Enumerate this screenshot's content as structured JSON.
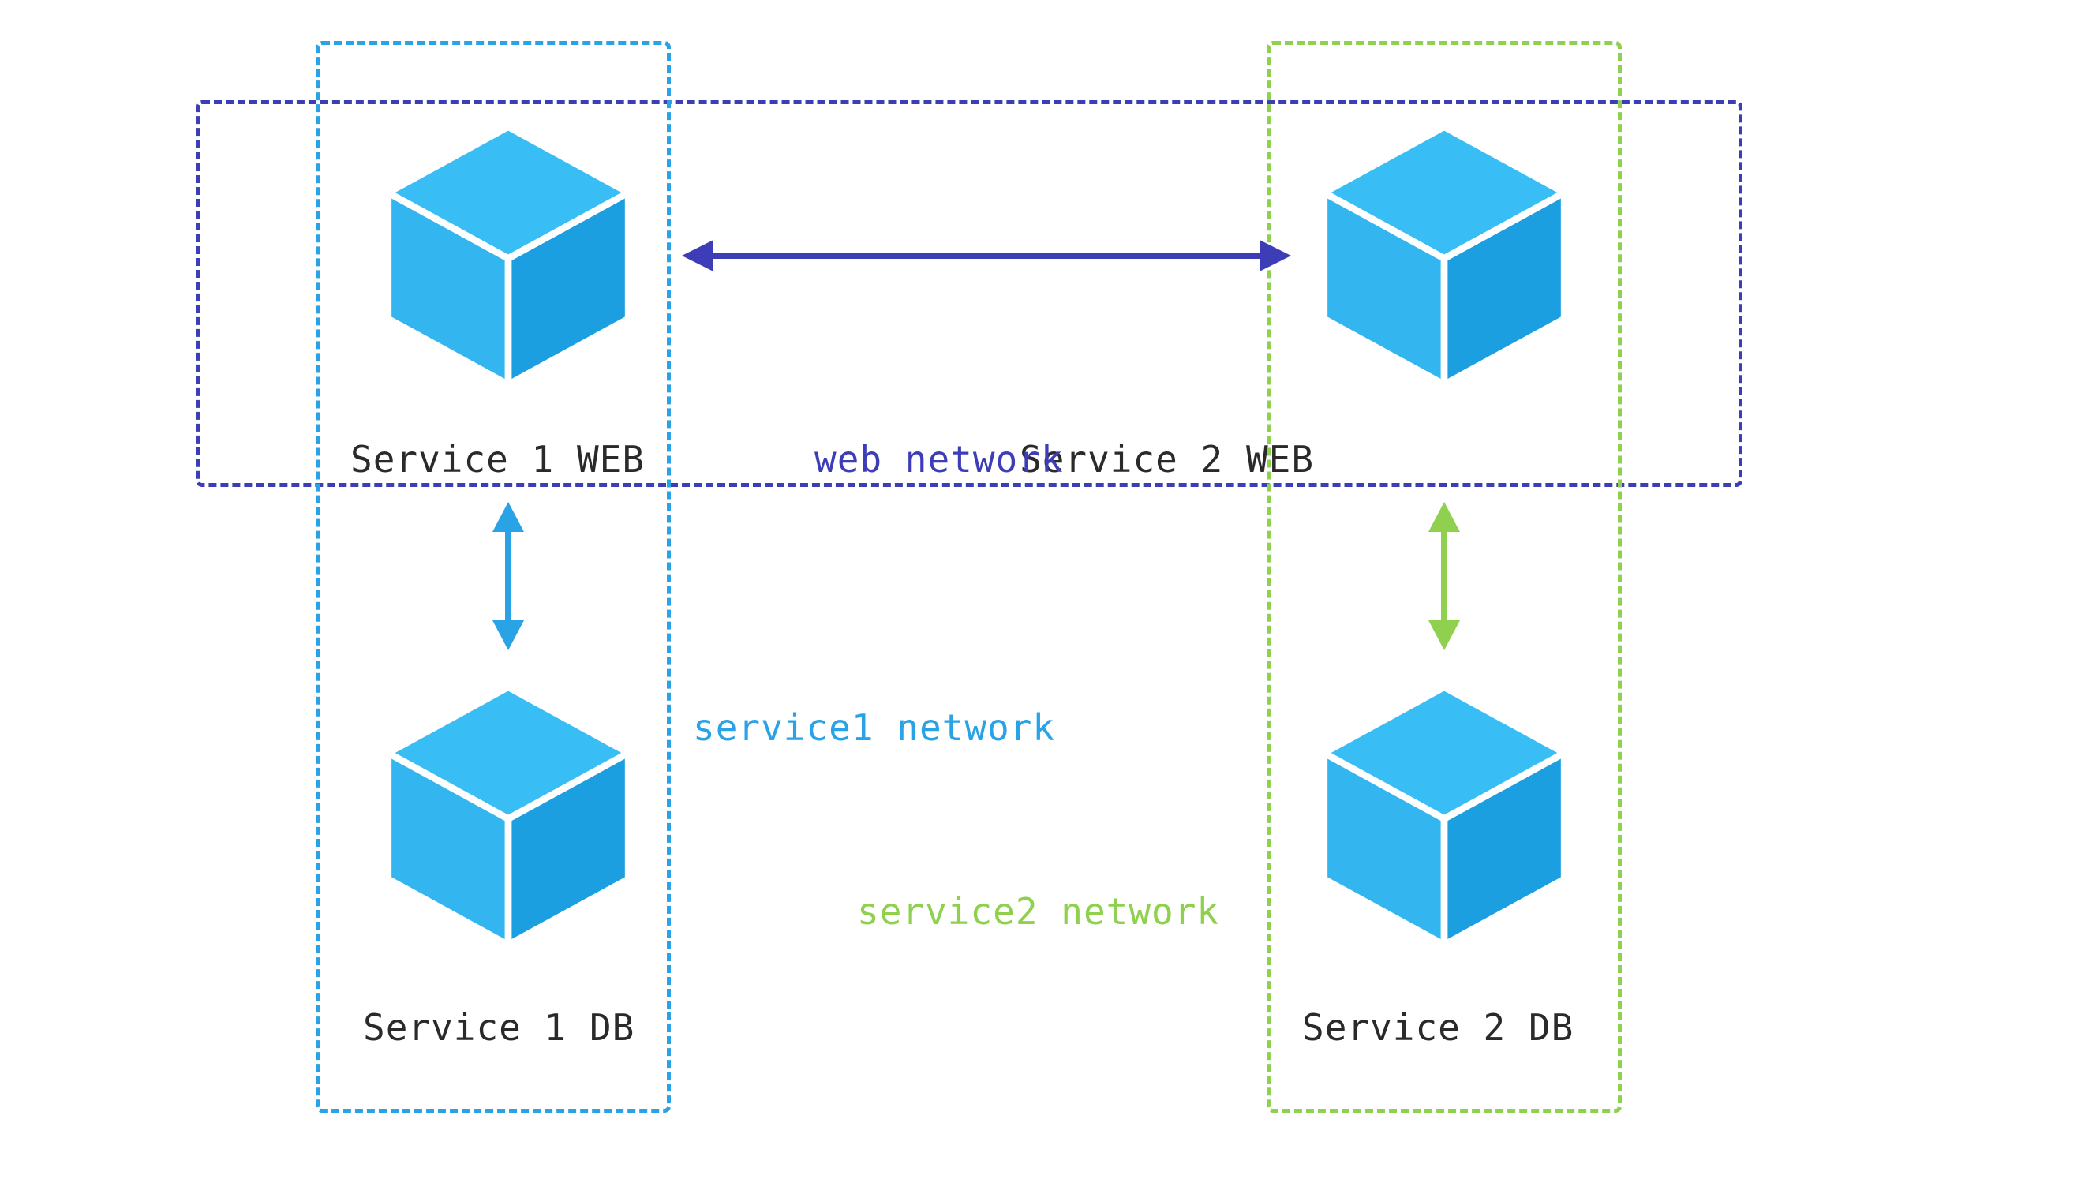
{
  "nodes": {
    "service1_web": {
      "label": "Service 1 WEB"
    },
    "service2_web": {
      "label": "Service 2 WEB"
    },
    "service1_db": {
      "label": "Service 1 DB"
    },
    "service2_db": {
      "label": "Service 2 DB"
    }
  },
  "networks": {
    "web": {
      "label": "web network",
      "color": "#3d3db8"
    },
    "service1": {
      "label": "service1 network",
      "color": "#2aa3e6"
    },
    "service2": {
      "label": "service2 network",
      "color": "#8fd14f"
    }
  },
  "colors": {
    "cube_light": "#33b5f0",
    "cube_dark": "#1c9fe0",
    "cube_top": "#39bdf5",
    "text_dark": "#2a2a2a"
  }
}
